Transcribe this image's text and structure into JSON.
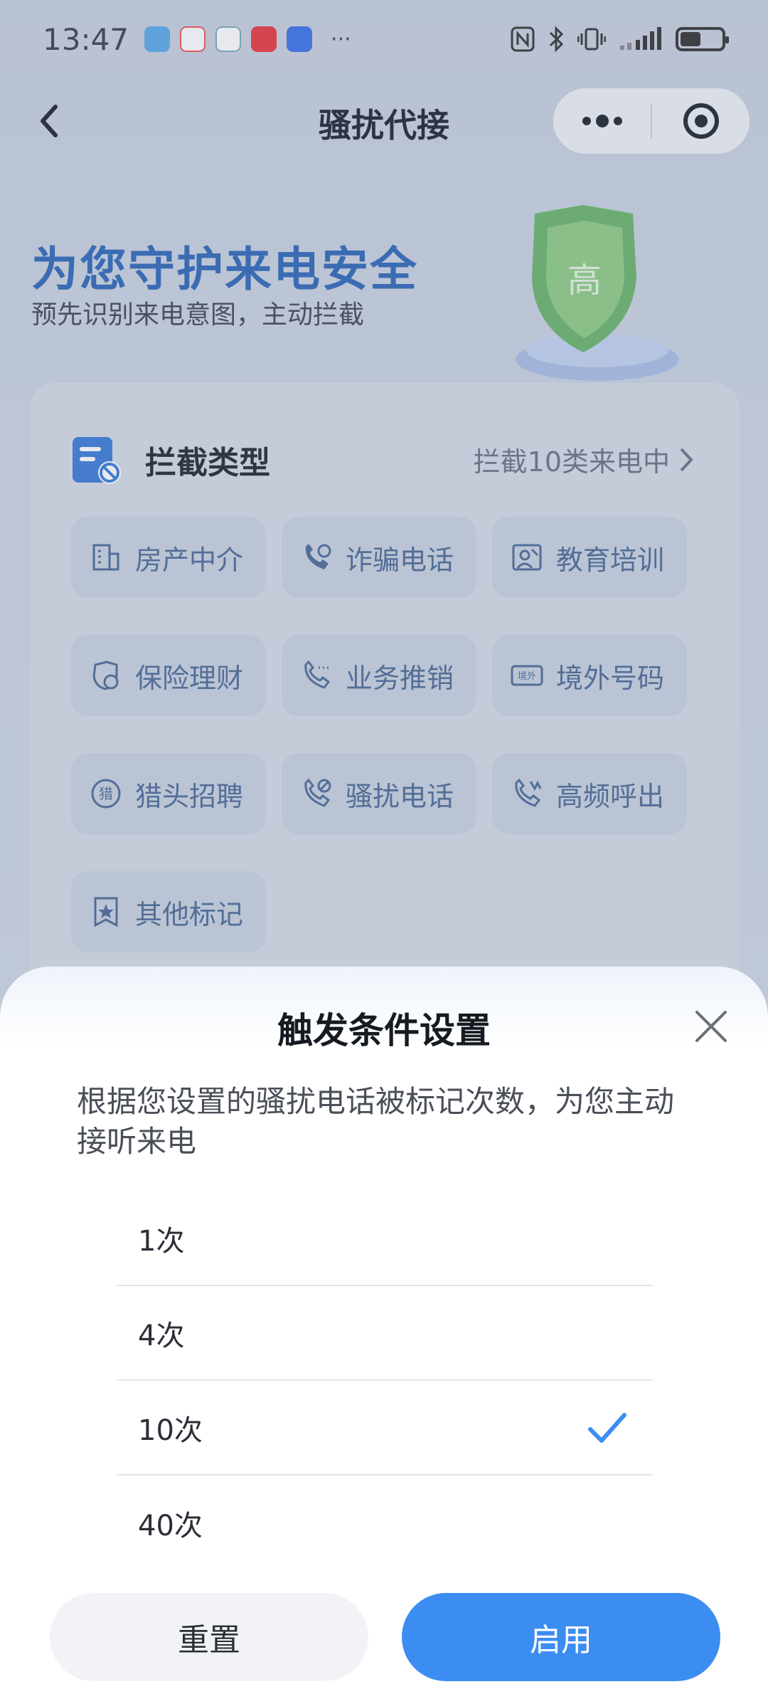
{
  "status_bar": {
    "time": "13:47",
    "more": "···"
  },
  "nav": {
    "title": "骚扰代接"
  },
  "hero": {
    "title": "为您守护来电安全",
    "subtitle": "预先识别来电意图，主动拦截",
    "badge": "高"
  },
  "card": {
    "title": "拦截类型",
    "link": "拦截10类来电中",
    "chips": [
      {
        "label": "房产中介",
        "icon": "building-icon"
      },
      {
        "label": "诈骗电话",
        "icon": "fraud-phone-icon"
      },
      {
        "label": "教育培训",
        "icon": "education-icon"
      },
      {
        "label": "保险理财",
        "icon": "insurance-icon"
      },
      {
        "label": "业务推销",
        "icon": "sales-phone-icon"
      },
      {
        "label": "境外号码",
        "icon": "overseas-icon",
        "icon_text": "境外"
      },
      {
        "label": "猎头招聘",
        "icon": "headhunter-icon",
        "icon_text": "猎"
      },
      {
        "label": "骚扰电话",
        "icon": "harassment-phone-icon"
      },
      {
        "label": "高频呼出",
        "icon": "high-frequency-icon"
      },
      {
        "label": "其他标记",
        "icon": "other-mark-icon"
      }
    ]
  },
  "sheet": {
    "title": "触发条件设置",
    "description": "根据您设置的骚扰电话被标记次数，为您主动接听来电",
    "options": [
      {
        "label": "1次",
        "selected": false
      },
      {
        "label": "4次",
        "selected": false
      },
      {
        "label": "10次",
        "selected": true
      },
      {
        "label": "40次",
        "selected": false
      }
    ],
    "reset_label": "重置",
    "enable_label": "启用"
  },
  "colors": {
    "accent": "#3b8df2",
    "hero_title": "#2e67b8",
    "chip_text": "#4b6a95"
  }
}
